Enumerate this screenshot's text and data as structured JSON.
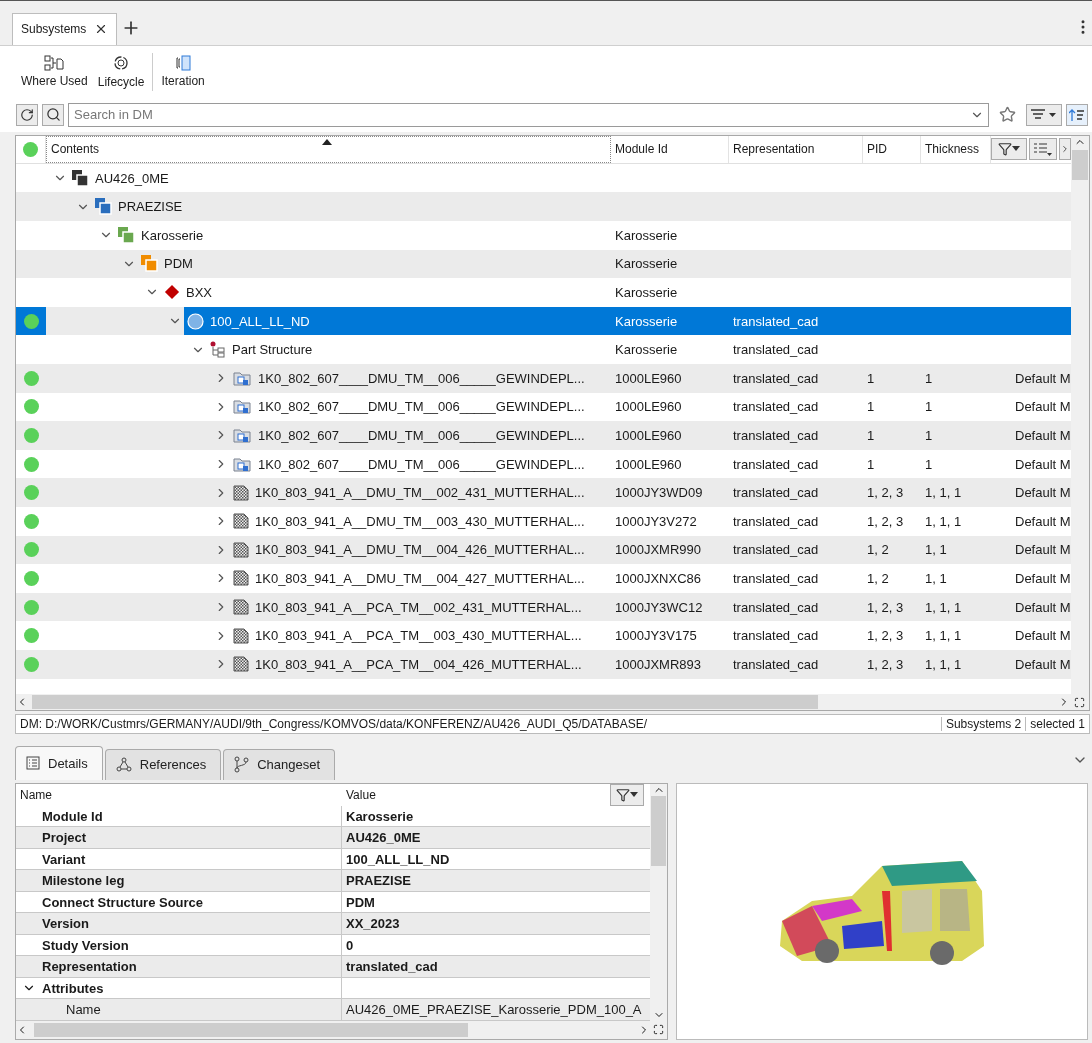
{
  "tabs": [
    {
      "label": "Subsystems",
      "selected": true
    }
  ],
  "toolbar": [
    {
      "label": "Where Used"
    },
    {
      "label": "Lifecycle"
    },
    {
      "label": "Iteration"
    }
  ],
  "search": {
    "placeholder": "Search in DM"
  },
  "table": {
    "columns": [
      "Contents",
      "Module Id",
      "Representation",
      "PID",
      "Thickness"
    ],
    "rows": [
      {
        "label": "AU426_0ME",
        "kind": "stack",
        "color": "#333333",
        "expanded": true,
        "selected": false,
        "indicator": false,
        "children": [
          {
            "label": "PRAEZISE",
            "kind": "stack",
            "color": "#2a6ebd",
            "expanded": true,
            "selected": false,
            "indicator": false,
            "children": [
              {
                "label": "Karosserie",
                "kind": "stack",
                "color": "#6aa84f",
                "expanded": true,
                "selected": false,
                "indicator": false,
                "module_id": "Karosserie",
                "children": [
                  {
                    "label": "PDM",
                    "kind": "stack",
                    "color": "#f08c00",
                    "expanded": true,
                    "selected": false,
                    "indicator": false,
                    "module_id": "Karosserie",
                    "children": [
                      {
                        "label": "BXX",
                        "kind": "diamond",
                        "color": "#c00000",
                        "expanded": true,
                        "selected": false,
                        "indicator": false,
                        "module_id": "Karosserie",
                        "children": [
                          {
                            "label": "100_ALL_LL_ND",
                            "kind": "variant",
                            "expanded": true,
                            "selected": true,
                            "indicator": true,
                            "module_id": "Karosserie",
                            "representation": "translated_cad",
                            "children": [
                              {
                                "label": "Part Structure",
                                "kind": "structure",
                                "expanded": true,
                                "selected": false,
                                "indicator": false,
                                "module_id": "Karosserie",
                                "representation": "translated_cad",
                                "children": [
                                  {
                                    "label": "1K0_802_607____DMU_TM__006_____GEWINDEPL...",
                                    "kind": "assembly",
                                    "expanded": false,
                                    "selected": false,
                                    "indicator": true,
                                    "module_id": "1000LE960",
                                    "representation": "translated_cad",
                                    "pid": "1",
                                    "thickness": "1",
                                    "column_6": "Default M"
                                  },
                                  {
                                    "label": "1K0_802_607____DMU_TM__006_____GEWINDEPL...",
                                    "kind": "assembly",
                                    "expanded": false,
                                    "selected": false,
                                    "indicator": true,
                                    "module_id": "1000LE960",
                                    "representation": "translated_cad",
                                    "pid": "1",
                                    "thickness": "1",
                                    "column_6": "Default M"
                                  },
                                  {
                                    "label": "1K0_802_607____DMU_TM__006_____GEWINDEPL...",
                                    "kind": "assembly",
                                    "expanded": false,
                                    "selected": false,
                                    "indicator": true,
                                    "module_id": "1000LE960",
                                    "representation": "translated_cad",
                                    "pid": "1",
                                    "thickness": "1",
                                    "column_6": "Default M"
                                  },
                                  {
                                    "label": "1K0_802_607____DMU_TM__006_____GEWINDEPL...",
                                    "kind": "assembly",
                                    "expanded": false,
                                    "selected": false,
                                    "indicator": true,
                                    "module_id": "1000LE960",
                                    "representation": "translated_cad",
                                    "pid": "1",
                                    "thickness": "1",
                                    "column_6": "Default M"
                                  },
                                  {
                                    "label": "1K0_803_941_A__DMU_TM__002_431_MUTTERHAL...",
                                    "kind": "part",
                                    "expanded": false,
                                    "selected": false,
                                    "indicator": true,
                                    "module_id": "1000JY3WD09",
                                    "representation": "translated_cad",
                                    "pid": "1, 2, 3",
                                    "thickness": "1, 1, 1",
                                    "column_6": "Default M"
                                  },
                                  {
                                    "label": "1K0_803_941_A__DMU_TM__003_430_MUTTERHAL...",
                                    "kind": "part",
                                    "expanded": false,
                                    "selected": false,
                                    "indicator": true,
                                    "module_id": "1000JY3V272",
                                    "representation": "translated_cad",
                                    "pid": "1, 2, 3",
                                    "thickness": "1, 1, 1",
                                    "column_6": "Default M"
                                  },
                                  {
                                    "label": "1K0_803_941_A__DMU_TM__004_426_MUTTERHAL...",
                                    "kind": "part",
                                    "expanded": false,
                                    "selected": false,
                                    "indicator": true,
                                    "module_id": "1000JXMR990",
                                    "representation": "translated_cad",
                                    "pid": "1, 2",
                                    "thickness": "1, 1",
                                    "column_6": "Default M"
                                  },
                                  {
                                    "label": "1K0_803_941_A__DMU_TM__004_427_MUTTERHAL...",
                                    "kind": "part",
                                    "expanded": false,
                                    "selected": false,
                                    "indicator": true,
                                    "module_id": "1000JXNXC86",
                                    "representation": "translated_cad",
                                    "pid": "1, 2",
                                    "thickness": "1, 1",
                                    "column_6": "Default M"
                                  },
                                  {
                                    "label": "1K0_803_941_A__PCA_TM__002_431_MUTTERHAL...",
                                    "kind": "part",
                                    "expanded": false,
                                    "selected": false,
                                    "indicator": true,
                                    "module_id": "1000JY3WC12",
                                    "representation": "translated_cad",
                                    "pid": "1, 2, 3",
                                    "thickness": "1, 1, 1",
                                    "column_6": "Default M"
                                  },
                                  {
                                    "label": "1K0_803_941_A__PCA_TM__003_430_MUTTERHAL...",
                                    "kind": "part",
                                    "expanded": false,
                                    "selected": false,
                                    "indicator": true,
                                    "module_id": "1000JY3V175",
                                    "representation": "translated_cad",
                                    "pid": "1, 2, 3",
                                    "thickness": "1, 1, 1",
                                    "column_6": "Default M"
                                  },
                                  {
                                    "label": "1K0_803_941_A__PCA_TM__004_426_MUTTERHAL...",
                                    "kind": "part",
                                    "expanded": false,
                                    "selected": false,
                                    "indicator": true,
                                    "module_id": "1000JXMR893",
                                    "representation": "translated_cad",
                                    "pid": "1, 2, 3",
                                    "thickness": "1, 1, 1",
                                    "column_6": "Default M"
                                  }
                                ]
                              }
                            ]
                          }
                        ]
                      }
                    ]
                  }
                ]
              }
            ]
          }
        ]
      }
    ]
  },
  "status_bar": {
    "path": "DM: D:/WORK/Custmrs/GERMANY/AUDI/9th_Congress/KOMVOS/data/KONFERENZ/AU426_AUDI_Q5/DATABASE/",
    "items": [
      "Subsystems 2",
      "selected 1"
    ]
  },
  "bottom_tabs": [
    {
      "label": "Details",
      "selected": true
    },
    {
      "label": "References",
      "selected": false
    },
    {
      "label": "Changeset",
      "selected": false
    }
  ],
  "details": {
    "columns": [
      "Name",
      "Value"
    ],
    "rows": [
      {
        "name": "Module Id",
        "value": "Karosserie"
      },
      {
        "name": "Project",
        "value": "AU426_0ME"
      },
      {
        "name": "Variant",
        "value": "100_ALL_LL_ND"
      },
      {
        "name": "Milestone leg",
        "value": "PRAEZISE"
      },
      {
        "name": "Connect Structure Source",
        "value": "PDM"
      },
      {
        "name": "Version",
        "value": "XX_2023"
      },
      {
        "name": "Study Version",
        "value": "0"
      },
      {
        "name": "Representation",
        "value": "translated_cad"
      },
      {
        "name": "Attributes",
        "expanded": true,
        "children": [
          {
            "name": "Name",
            "value": "AU426_0ME_PRAEZISE_Karosserie_PDM_100_A"
          }
        ]
      }
    ]
  }
}
